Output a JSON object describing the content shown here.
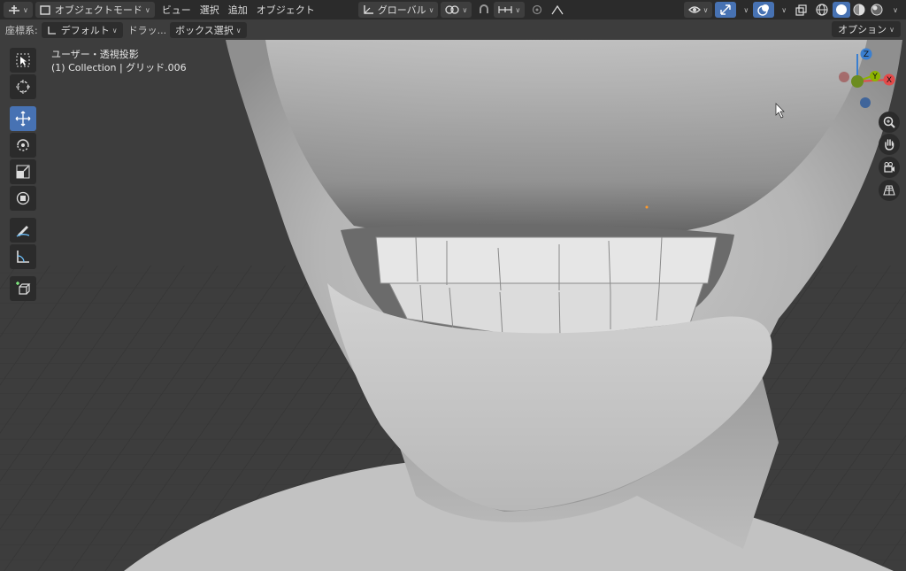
{
  "header": {
    "editor_type_icon": "editor-type-icon",
    "mode": "オブジェクトモード",
    "menus": [
      "ビュー",
      "選択",
      "追加",
      "オブジェクト"
    ],
    "transform_orientation": "グローバル",
    "shading_modes": [
      "wireframe",
      "solid",
      "material",
      "rendered"
    ]
  },
  "subbar": {
    "coord_label": "座標系:",
    "coord_value": "デフォルト",
    "drag_label": "ドラッ...",
    "select_mode": "ボックス選択",
    "options": "オプション"
  },
  "viewport": {
    "view_name": "ユーザー・透視投影",
    "collection_info": "(1) Collection | グリッド.006"
  },
  "gizmo": {
    "x_label": "X",
    "y_label": "Y",
    "z_label": "Z",
    "colors": {
      "x": "#e34a4a",
      "y": "#8db400",
      "z": "#3a7fd0"
    }
  },
  "tools": [
    "select-box-icon",
    "cursor-icon",
    "move-icon",
    "rotate-icon",
    "scale-icon",
    "transform-icon",
    "annotate-icon",
    "measure-icon",
    "add-cube-icon"
  ],
  "nav": [
    "zoom-icon",
    "pan-hand-icon",
    "camera-icon",
    "perspective-grid-icon"
  ],
  "colors": {
    "accent": "#4772b3",
    "header": "#2b2b2b",
    "viewport_bg": "#3d3d3d"
  }
}
